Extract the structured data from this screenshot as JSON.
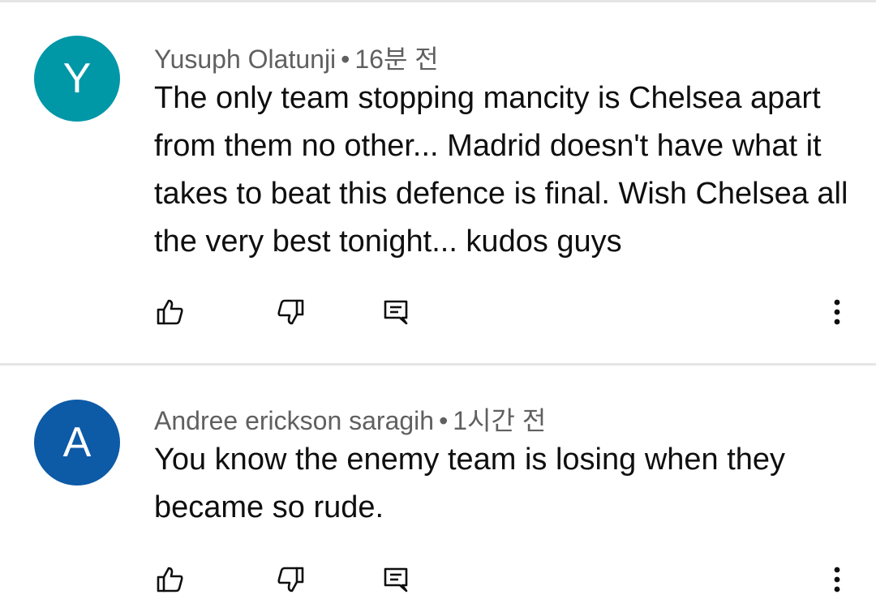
{
  "comments": [
    {
      "avatar_letter": "Y",
      "avatar_color": "#0097a7",
      "author": "Yusuph Olatunji",
      "separator": "•",
      "time": "16분 전",
      "text": "The only team stopping mancity is Chelsea apart from them no other... Madrid doesn't have what it takes to beat this defence is final. Wish Chelsea all the very best tonight... kudos guys"
    },
    {
      "avatar_letter": "A",
      "avatar_color": "#0d5aa7",
      "author": "Andree erickson saragih",
      "separator": "•",
      "time": "1시간 전",
      "text": "You know the enemy team is losing when they became so rude."
    }
  ],
  "icons": {
    "like": "thumbs-up-icon",
    "dislike": "thumbs-down-icon",
    "reply": "reply-icon",
    "menu": "more-vert-icon"
  },
  "colors": {
    "meta_text": "#606060",
    "body_text": "#0f0f0f",
    "divider": "#e5e5e5"
  }
}
